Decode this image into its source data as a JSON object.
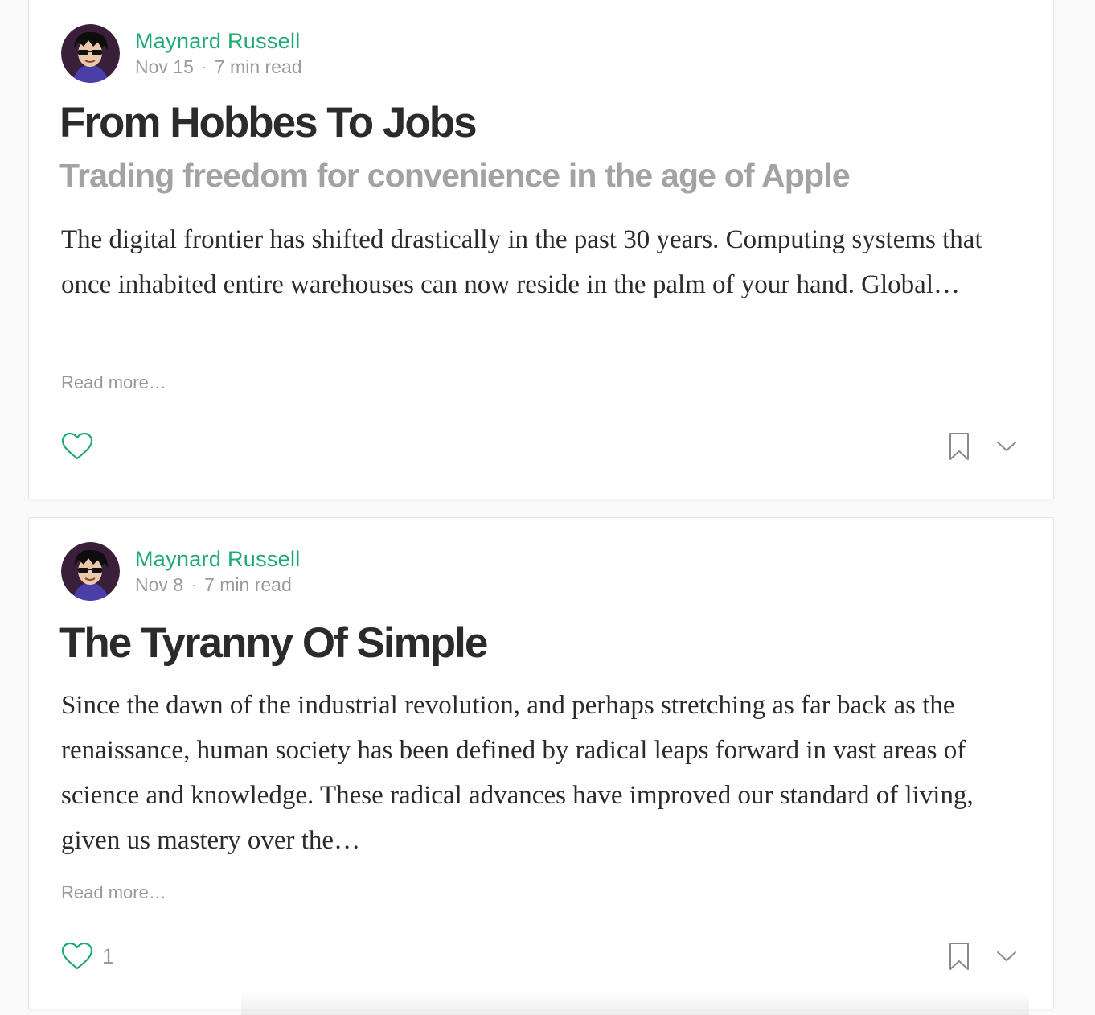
{
  "colors": {
    "accent": "#1ea971",
    "title": "#2b2b2b",
    "muted": "#9b9b9b",
    "card_bg": "#ffffff",
    "page_bg": "#fafafa"
  },
  "posts": [
    {
      "author": "Maynard Russell",
      "date": "Nov 15",
      "separator": "·",
      "read_time": "7 min read",
      "title": "From Hobbes To Jobs",
      "subtitle": "Trading freedom for convenience in the age of Apple",
      "excerpt": "The digital frontier has shifted drastically in the past 30 years. Computing systems that once inhabited entire warehouses can now reside in the palm of your hand. Global…",
      "read_more": "Read more…",
      "like_count": "",
      "icons": [
        "avatar",
        "heart-icon",
        "bookmark-icon",
        "chevron-down-icon"
      ]
    },
    {
      "author": "Maynard Russell",
      "date": "Nov 8",
      "separator": "·",
      "read_time": "7 min read",
      "title": "The Tyranny Of Simple",
      "excerpt": "Since the dawn of the industrial revolution, and perhaps stretching as far back as the renaissance, human society has been defined by radical leaps forward in vast areas of science and knowledge. These radical advances have improved our standard of living, given us mastery over the…",
      "read_more": "Read more…",
      "like_count": "1",
      "icons": [
        "avatar",
        "heart-icon",
        "bookmark-icon",
        "chevron-down-icon"
      ]
    }
  ]
}
